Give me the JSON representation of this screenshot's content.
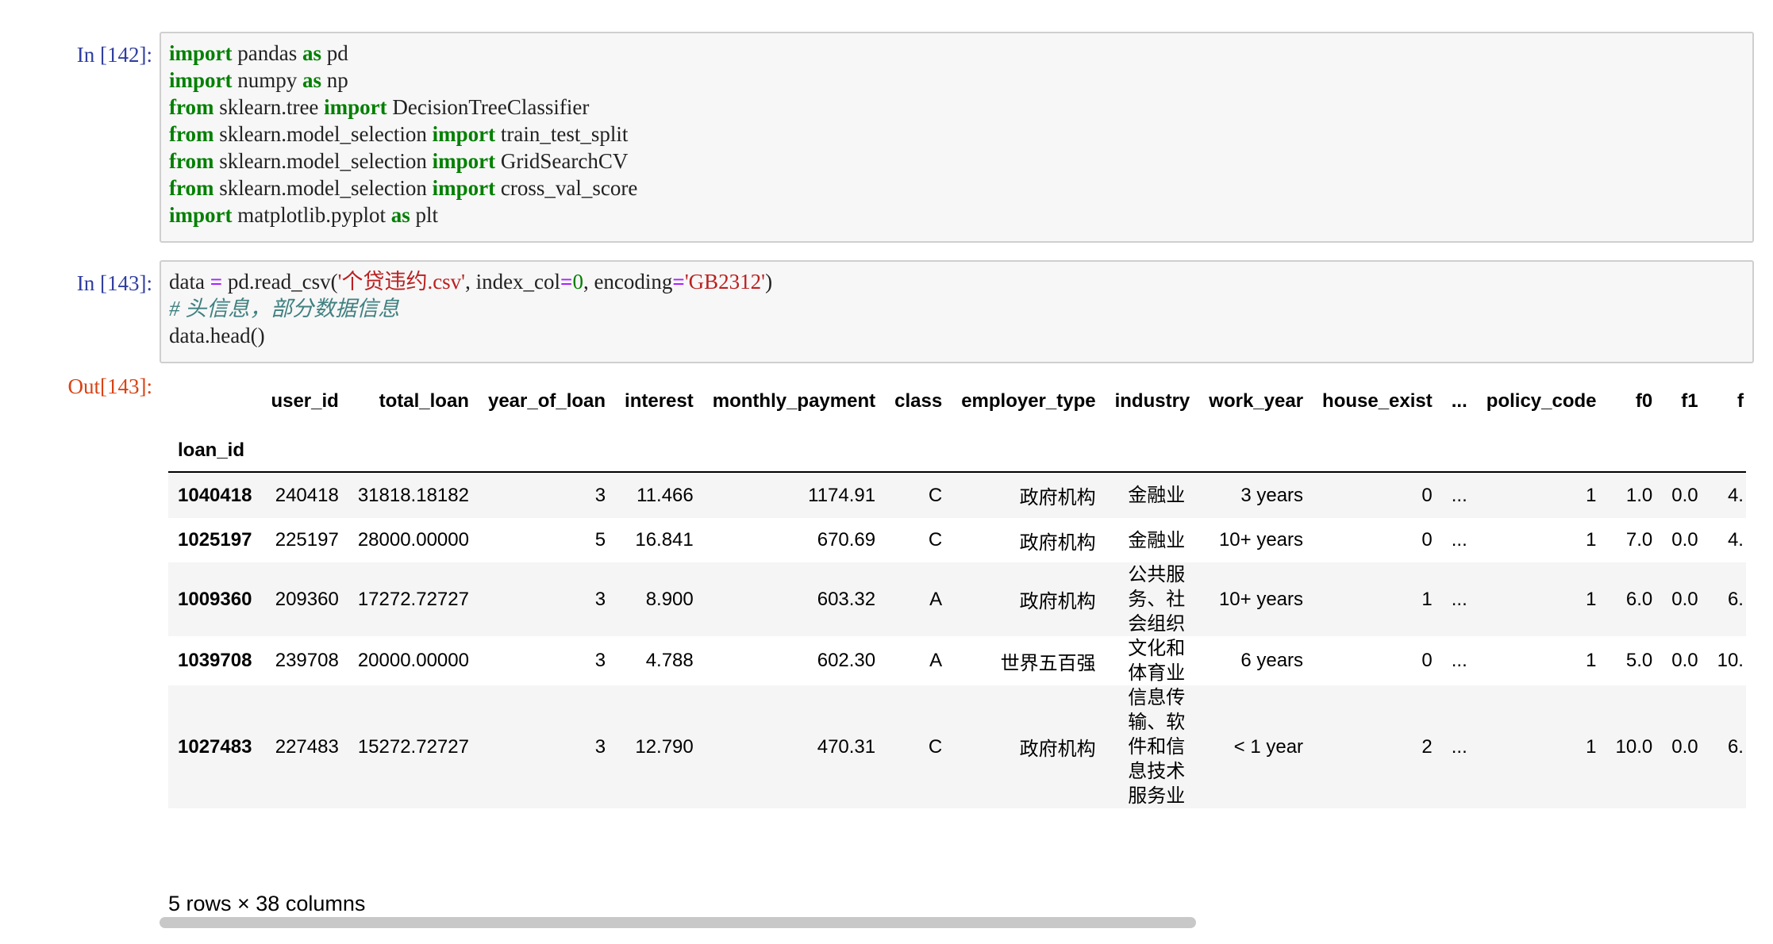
{
  "cells": [
    {
      "prompt": "In  [142]:",
      "lines": [
        [
          {
            "t": "import",
            "c": "kw"
          },
          {
            "t": " pandas ",
            "c": ""
          },
          {
            "t": "as",
            "c": "kw"
          },
          {
            "t": " pd",
            "c": ""
          }
        ],
        [
          {
            "t": "import",
            "c": "kw"
          },
          {
            "t": " numpy ",
            "c": ""
          },
          {
            "t": "as",
            "c": "kw"
          },
          {
            "t": " np",
            "c": ""
          }
        ],
        [
          {
            "t": "from",
            "c": "kw"
          },
          {
            "t": " sklearn.tree ",
            "c": ""
          },
          {
            "t": "import",
            "c": "kw"
          },
          {
            "t": " DecisionTreeClassifier",
            "c": ""
          }
        ],
        [
          {
            "t": "from",
            "c": "kw"
          },
          {
            "t": " sklearn.model_selection ",
            "c": ""
          },
          {
            "t": "import",
            "c": "kw"
          },
          {
            "t": " train_test_split",
            "c": ""
          }
        ],
        [
          {
            "t": "from",
            "c": "kw"
          },
          {
            "t": " sklearn.model_selection ",
            "c": ""
          },
          {
            "t": "import",
            "c": "kw"
          },
          {
            "t": " GridSearchCV",
            "c": ""
          }
        ],
        [
          {
            "t": "from",
            "c": "kw"
          },
          {
            "t": " sklearn.model_selection ",
            "c": ""
          },
          {
            "t": "import",
            "c": "kw"
          },
          {
            "t": " cross_val_score",
            "c": ""
          }
        ],
        [
          {
            "t": "import",
            "c": "kw"
          },
          {
            "t": " matplotlib.pyplot ",
            "c": ""
          },
          {
            "t": "as",
            "c": "kw"
          },
          {
            "t": " plt",
            "c": ""
          }
        ]
      ]
    },
    {
      "prompt": "In  [143]:",
      "lines": [
        [
          {
            "t": "data ",
            "c": ""
          },
          {
            "t": "=",
            "c": "op"
          },
          {
            "t": " pd.read_csv(",
            "c": ""
          },
          {
            "t": "'个贷违约.csv'",
            "c": "str"
          },
          {
            "t": ", index_col",
            "c": ""
          },
          {
            "t": "=",
            "c": "op"
          },
          {
            "t": "0",
            "c": "num"
          },
          {
            "t": ", encoding",
            "c": ""
          },
          {
            "t": "=",
            "c": "op"
          },
          {
            "t": "'GB2312'",
            "c": "str"
          },
          {
            "t": ")",
            "c": ""
          }
        ],
        [
          {
            "t": "# 头信息，部分数据信息",
            "c": "comment"
          }
        ],
        [
          {
            "t": "data.head()",
            "c": ""
          }
        ]
      ]
    }
  ],
  "output": {
    "prompt": "Out[143]:",
    "index_name": "loan_id",
    "columns": [
      "user_id",
      "total_loan",
      "year_of_loan",
      "interest",
      "monthly_payment",
      "class",
      "employer_type",
      "industry",
      "work_year",
      "house_exist",
      "...",
      "policy_code",
      "f0",
      "f1",
      "f"
    ],
    "rows": [
      {
        "index": "1040418",
        "cells": [
          "240418",
          "31818.18182",
          "3",
          "11.466",
          "1174.91",
          "C",
          "政府机构",
          "金融业",
          "3 years",
          "0",
          "...",
          "1",
          "1.0",
          "0.0",
          "4."
        ]
      },
      {
        "index": "1025197",
        "cells": [
          "225197",
          "28000.00000",
          "5",
          "16.841",
          "670.69",
          "C",
          "政府机构",
          "金融业",
          "10+ years",
          "0",
          "...",
          "1",
          "7.0",
          "0.0",
          "4."
        ]
      },
      {
        "index": "1009360",
        "cells": [
          "209360",
          "17272.72727",
          "3",
          "8.900",
          "603.32",
          "A",
          "政府机构",
          "公共服务、社会组织",
          "10+ years",
          "1",
          "...",
          "1",
          "6.0",
          "0.0",
          "6."
        ]
      },
      {
        "index": "1039708",
        "cells": [
          "239708",
          "20000.00000",
          "3",
          "4.788",
          "602.30",
          "A",
          "世界五百强",
          "文化和体育业",
          "6 years",
          "0",
          "...",
          "1",
          "5.0",
          "0.0",
          "10."
        ]
      },
      {
        "index": "1027483",
        "cells": [
          "227483",
          "15272.72727",
          "3",
          "12.790",
          "470.31",
          "C",
          "政府机构",
          "信息传输、软件和信息技术服务业",
          "< 1 year",
          "2",
          "...",
          "1",
          "10.0",
          "0.0",
          "6."
        ]
      }
    ],
    "shape_text": "5 rows × 38 columns"
  }
}
